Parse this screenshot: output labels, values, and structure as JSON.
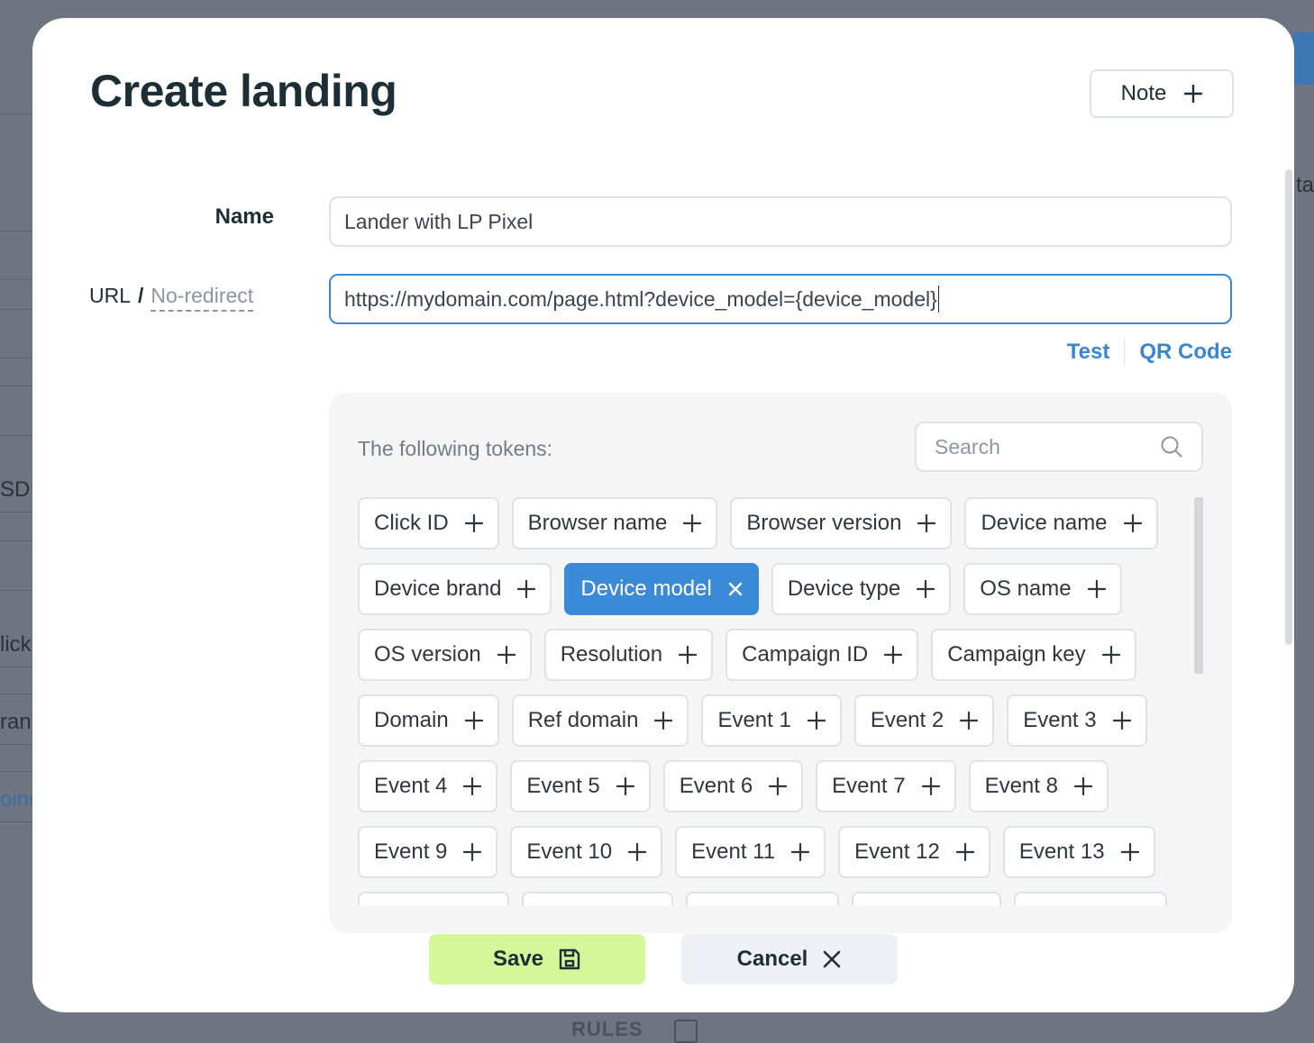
{
  "background": {
    "left_texts": [
      "SD",
      "lick",
      "ran",
      "oinc"
    ],
    "right_text": "ta",
    "bottom_text": "RULES"
  },
  "modal": {
    "title": "Create landing",
    "note_button": {
      "label": "Note"
    },
    "name_field": {
      "label": "Name",
      "value": "Lander with LP Pixel"
    },
    "url_field": {
      "label": "URL",
      "separator": "/",
      "toggle_label": "No-redirect",
      "value": "https://mydomain.com/page.html?device_model={device_model}"
    },
    "links": {
      "test": "Test",
      "qr_code": "QR Code"
    },
    "tokens": {
      "heading": "The following tokens:",
      "search_placeholder": "Search",
      "items": [
        {
          "label": "Click ID",
          "active": false
        },
        {
          "label": "Browser name",
          "active": false
        },
        {
          "label": "Browser version",
          "active": false
        },
        {
          "label": "Device name",
          "active": false
        },
        {
          "label": "Device brand",
          "active": false
        },
        {
          "label": "Device model",
          "active": true
        },
        {
          "label": "Device type",
          "active": false
        },
        {
          "label": "OS name",
          "active": false
        },
        {
          "label": "OS version",
          "active": false
        },
        {
          "label": "Resolution",
          "active": false
        },
        {
          "label": "Campaign ID",
          "active": false
        },
        {
          "label": "Campaign key",
          "active": false
        },
        {
          "label": "Domain",
          "active": false
        },
        {
          "label": "Ref domain",
          "active": false
        },
        {
          "label": "Event 1",
          "active": false
        },
        {
          "label": "Event 2",
          "active": false
        },
        {
          "label": "Event 3",
          "active": false
        },
        {
          "label": "Event 4",
          "active": false
        },
        {
          "label": "Event 5",
          "active": false
        },
        {
          "label": "Event 6",
          "active": false
        },
        {
          "label": "Event 7",
          "active": false
        },
        {
          "label": "Event 8",
          "active": false
        },
        {
          "label": "Event 9",
          "active": false
        },
        {
          "label": "Event 10",
          "active": false
        },
        {
          "label": "Event 11",
          "active": false
        },
        {
          "label": "Event 12",
          "active": false
        },
        {
          "label": "Event 13",
          "active": false
        }
      ]
    },
    "footer": {
      "save_label": "Save",
      "cancel_label": "Cancel"
    }
  },
  "colors": {
    "accent": "#3b8ad8",
    "save_bg": "#d4f79a",
    "cancel_bg": "#eef0f6",
    "overlay": "#6e7480"
  },
  "icons": {
    "note": "plus-icon",
    "token_add": "plus-icon",
    "token_remove": "close-icon",
    "search": "search-icon",
    "save": "floppy-disk-icon",
    "cancel": "close-icon"
  }
}
